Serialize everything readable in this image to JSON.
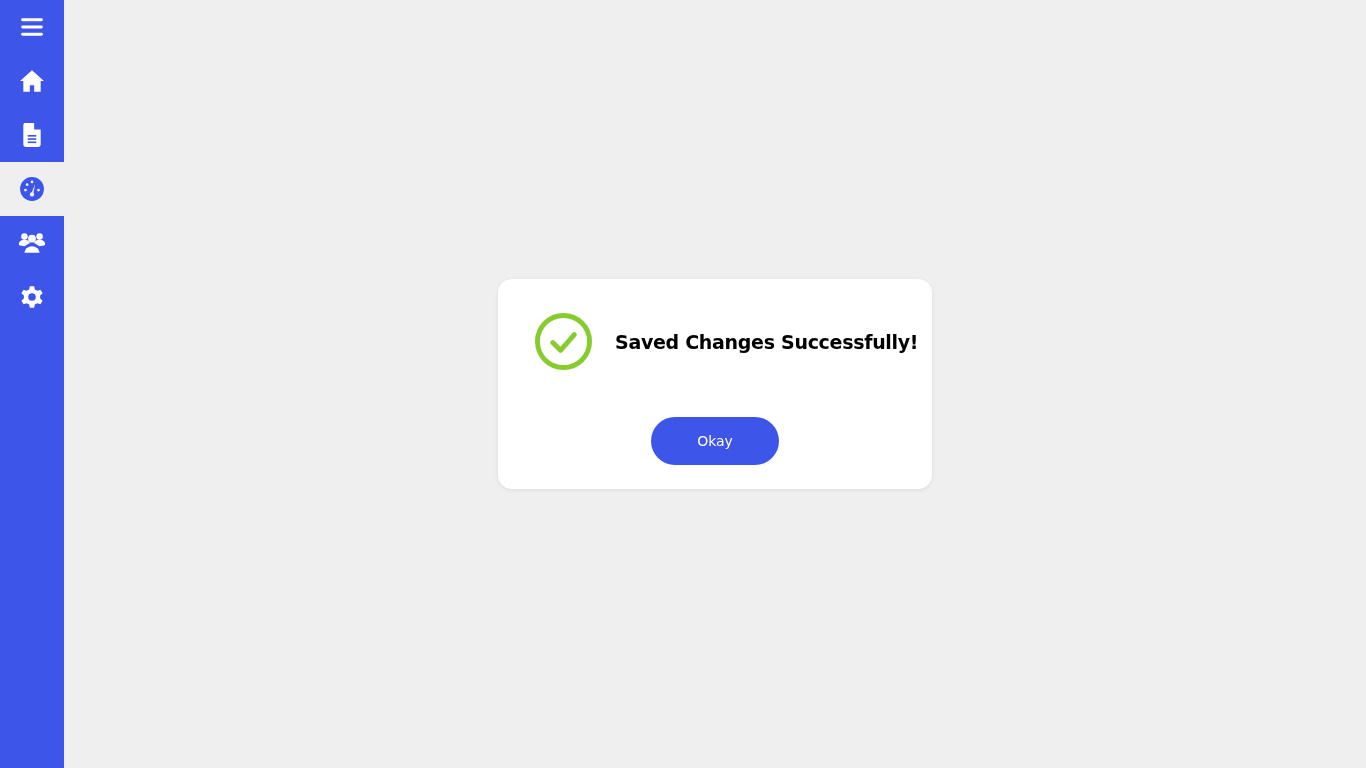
{
  "sidebar": {
    "items": [
      {
        "kind": "menu",
        "selected": false
      },
      {
        "kind": "home",
        "selected": false
      },
      {
        "kind": "document",
        "selected": false
      },
      {
        "kind": "dashboard",
        "selected": true
      },
      {
        "kind": "users",
        "selected": false
      },
      {
        "kind": "settings",
        "selected": false
      }
    ]
  },
  "dialog": {
    "kind": "success",
    "message": "Saved Changes Successfully!",
    "button": "Okay"
  }
}
